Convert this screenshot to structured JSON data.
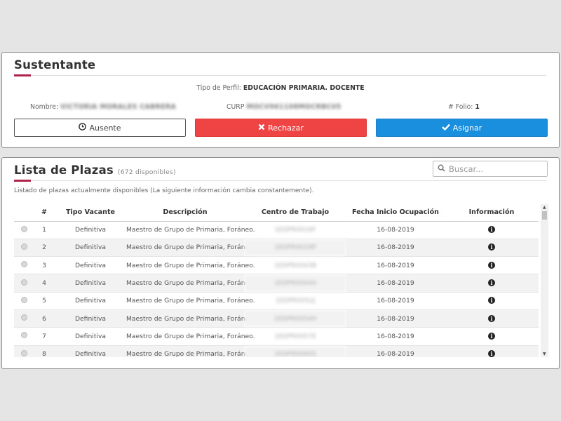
{
  "sustentante": {
    "title": "Sustentante",
    "perfil_label": "Tipo de Perfil:",
    "perfil_value": "EDUCACIÓN PRIMARIA. DOCENTE",
    "nombre_label": "Nombre:",
    "nombre_value": "VICTORIA MORALES CABRERA",
    "curp_label": "CURP",
    "curp_value": "MOCV961108MOCRBC05",
    "folio_label": "# Folio:",
    "folio_value": "1",
    "buttons": {
      "ausente": "Ausente",
      "rechazar": "Rechazar",
      "asignar": "Asignar"
    },
    "colors": {
      "accent": "#b0234b",
      "rechazar": "#ee4444",
      "asignar": "#1a8fde"
    }
  },
  "plazas": {
    "title": "Lista de Plazas",
    "available": "(672 disponibles)",
    "search_placeholder": "Buscar...",
    "description": "Listado de plazas actualmente disponibles (La siguiente información cambia constantemente).",
    "columns": [
      "#",
      "Tipo Vacante",
      "Descripción",
      "Centro de Trabajo",
      "Fecha Inicio Ocupación",
      "Información"
    ],
    "rows": [
      {
        "num": "1",
        "tipo": "Definitiva",
        "desc": "Maestro de Grupo de Primaria, Foráneo.",
        "centro": "1EDPR0016F",
        "fecha": "16-08-2019"
      },
      {
        "num": "2",
        "tipo": "Definitiva",
        "desc": "Maestro de Grupo de Primaria, Foráneo.",
        "centro": "1EDPR0018P",
        "fecha": "16-08-2019"
      },
      {
        "num": "3",
        "tipo": "Definitiva",
        "desc": "Maestro de Grupo de Primaria, Foráneo.",
        "centro": "1EDPR0043B",
        "fecha": "16-08-2019"
      },
      {
        "num": "4",
        "tipo": "Definitiva",
        "desc": "Maestro de Grupo de Primaria, Foráneo.",
        "centro": "1EDPR0044A",
        "fecha": "16-08-2019"
      },
      {
        "num": "5",
        "tipo": "Definitiva",
        "desc": "Maestro de Grupo de Primaria, Foráneo.",
        "centro": "1EDPR0052J",
        "fecha": "16-08-2019"
      },
      {
        "num": "6",
        "tipo": "Definitiva",
        "desc": "Maestro de Grupo de Primaria, Foráneo.",
        "centro": "1EDPR0054H",
        "fecha": "16-08-2019"
      },
      {
        "num": "7",
        "tipo": "Definitiva",
        "desc": "Maestro de Grupo de Primaria, Foráneo.",
        "centro": "1EDPR0057E",
        "fecha": "16-08-2019"
      },
      {
        "num": "8",
        "tipo": "Definitiva",
        "desc": "Maestro de Grupo de Primaria, Foráneo.",
        "centro": "1EDPR0060S",
        "fecha": "16-08-2019"
      }
    ]
  }
}
